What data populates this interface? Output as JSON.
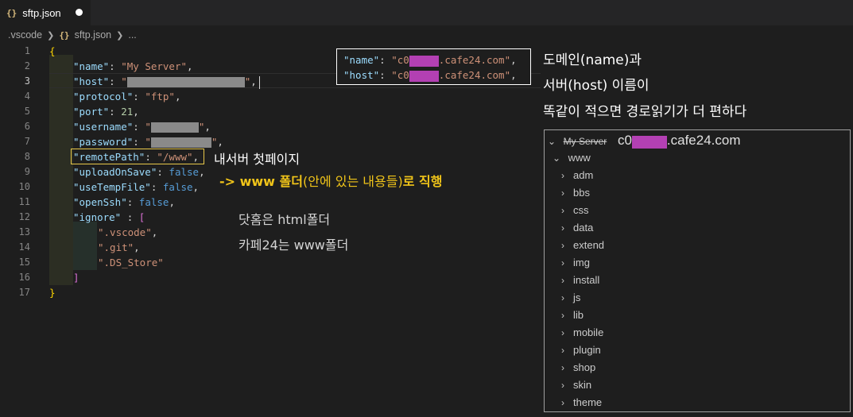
{
  "tab": {
    "icon": "{}",
    "label": "sftp.json"
  },
  "breadcrumb": {
    "folder": ".vscode",
    "file_icon": "{}",
    "file": "sftp.json",
    "more": "..."
  },
  "line_numbers": [
    "1",
    "2",
    "3",
    "4",
    "5",
    "6",
    "7",
    "8",
    "9",
    "10",
    "11",
    "12",
    "13",
    "14",
    "15",
    "16",
    "17"
  ],
  "code": {
    "open_brace": "{",
    "name_key": "\"name\"",
    "name_val": "\"My Server\"",
    "host_key": "\"host\"",
    "protocol_key": "\"protocol\"",
    "protocol_val": "\"ftp\"",
    "port_key": "\"port\"",
    "port_val": "21",
    "username_key": "\"username\"",
    "password_key": "\"password\"",
    "remotePath_key": "\"remotePath\"",
    "remotePath_val": "\"/www\"",
    "uploadOnSave_key": "\"uploadOnSave\"",
    "uploadOnSave_val": "false",
    "useTempFile_key": "\"useTempFile\"",
    "useTempFile_val": "false",
    "openSsh_key": "\"openSsh\"",
    "openSsh_val": "false",
    "ignore_key": "\"ignore\"",
    "ignore_open": "[",
    "ignore_items": [
      "\".vscode\"",
      "\".git\"",
      "\".DS_Store\""
    ],
    "ignore_close": "]",
    "close_brace": "}"
  },
  "popup": {
    "name_key": "\"name\"",
    "name_prefix": "\"c0",
    "name_suffix": ".cafe24.com\"",
    "host_key": "\"host\"",
    "host_prefix": "\"c0",
    "host_suffix": ".cafe24.com\""
  },
  "annotations": {
    "domain_line1": "도메인(name)과",
    "domain_line2": "서버(host) 이름이",
    "domain_line3": "똑같이 적으면 경로읽기가 더 편하다",
    "remote_note": "내서버 첫페이지",
    "arrow_prefix": "-> www 폴더",
    "arrow_paren": "(안에 있는 내용들)",
    "arrow_suffix": "로 직행",
    "dothome_note": "닷홈은 html폴더",
    "cafe24_note": "카페24는 www폴더"
  },
  "explorer": {
    "root_label": "My Server",
    "root_host_prefix": "c0",
    "root_host_suffix": ".cafe24.com",
    "folder": "www",
    "children": [
      "adm",
      "bbs",
      "css",
      "data",
      "extend",
      "img",
      "install",
      "js",
      "lib",
      "mobile",
      "plugin",
      "shop",
      "skin",
      "theme"
    ]
  },
  "colors": {
    "key": "#9cdcfe",
    "string": "#ce9178",
    "number": "#b5cea8",
    "bool": "#569cd6",
    "annotation_yellow": "#f0c419",
    "redact_magenta": "#b340b3"
  }
}
